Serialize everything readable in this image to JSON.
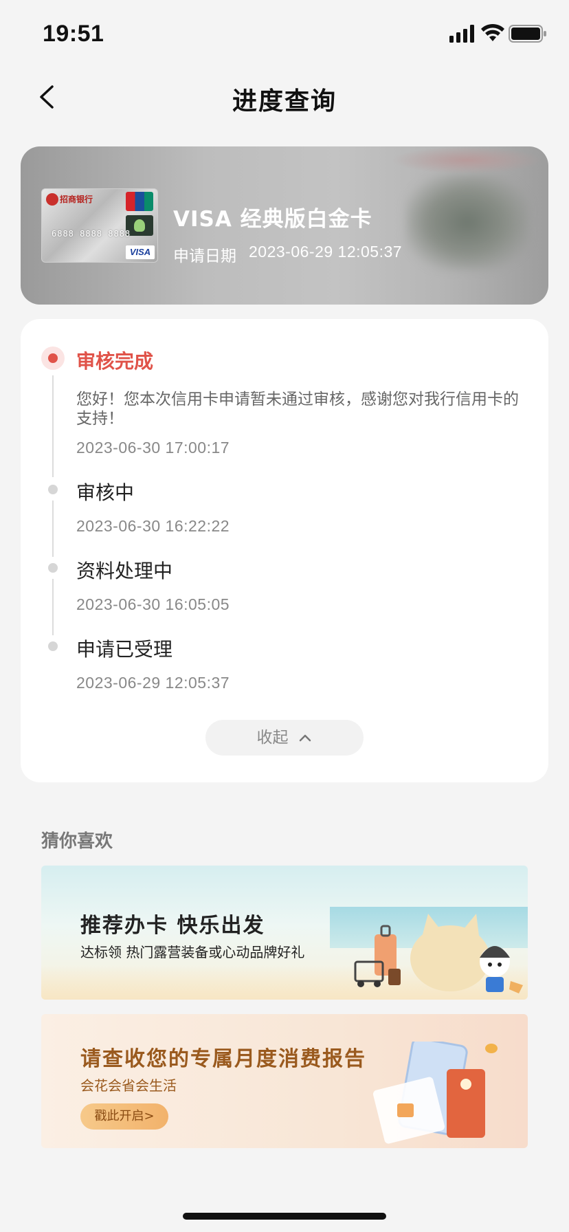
{
  "status_bar": {
    "time": "19:51"
  },
  "nav": {
    "title": "进度查询"
  },
  "card": {
    "name": "VISA 经典版白金卡",
    "apply_date_label": "申请日期",
    "apply_date": "2023-06-29 12:05:37",
    "bank_name": "招商银行",
    "card_number": "6888 8888 8888",
    "brand": "VISA"
  },
  "progress": {
    "steps": [
      {
        "title": "审核完成",
        "message": "您好！您本次信用卡申请暂未通过审核，感谢您对我行信用卡的支持！",
        "time": "2023-06-30 17:00:17",
        "active": true
      },
      {
        "title": "审核中",
        "time": "2023-06-30 16:22:22",
        "active": false
      },
      {
        "title": "资料处理中",
        "time": "2023-06-30 16:05:05",
        "active": false
      },
      {
        "title": "申请已受理",
        "time": "2023-06-29 12:05:37",
        "active": false
      }
    ],
    "collapse_label": "收起"
  },
  "recommend": {
    "section_title": "猜你喜欢",
    "banners": [
      {
        "title": "推荐办卡  快乐出发",
        "subtitle": "达标领 热门露营装备或心动品牌好礼"
      },
      {
        "title": "请查收您的专属月度消费报告",
        "subtitle": "会花会省会生活",
        "cta": "戳此开启>"
      }
    ]
  },
  "colors": {
    "accent": "#e05349",
    "background": "#f4f4f4",
    "report_text": "#9a5a1e"
  }
}
